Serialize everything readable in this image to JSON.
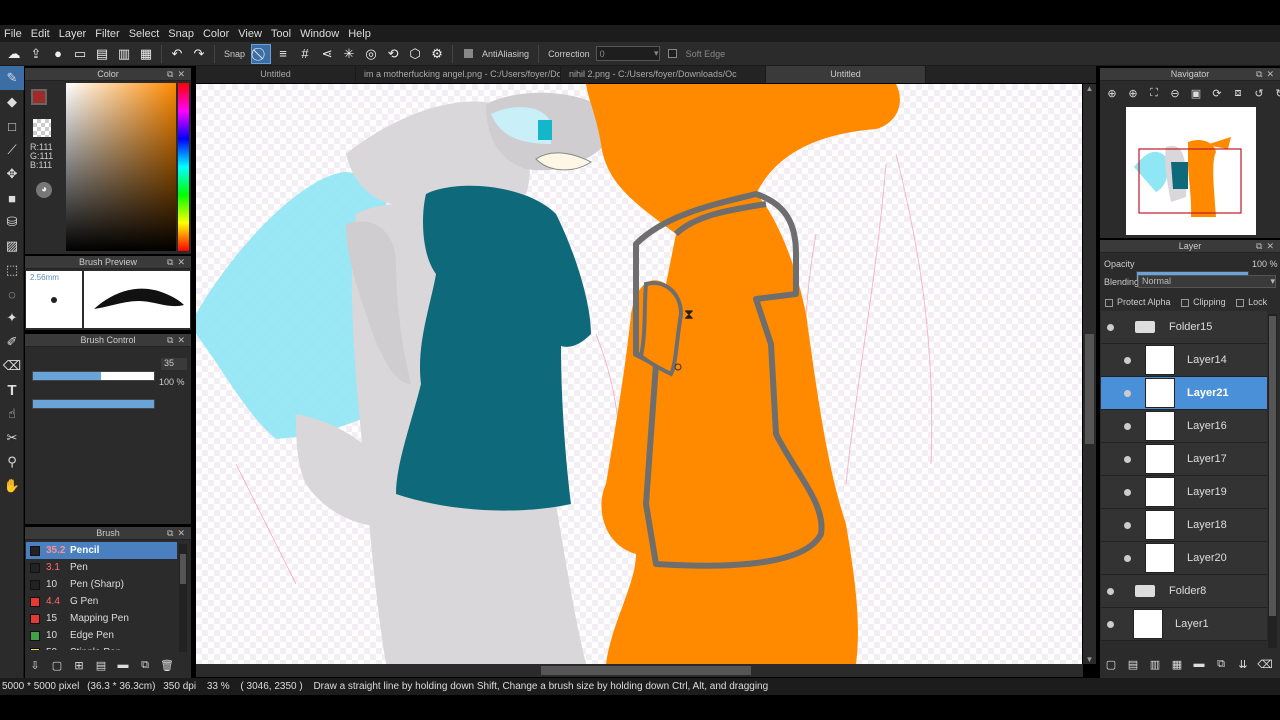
{
  "menu": [
    "File",
    "Edit",
    "Layer",
    "Filter",
    "Select",
    "Snap",
    "Color",
    "View",
    "Tool",
    "Window",
    "Help"
  ],
  "toolbar": {
    "snap_label": "Snap",
    "antialias_label": "AntiAliasing",
    "correction_label": "Correction",
    "correction_value": "0",
    "soft_edge_label": "Soft Edge"
  },
  "color_panel": {
    "title": "Color",
    "r": "R:111",
    "g": "G:111",
    "b": "B:111",
    "fg_color": "#a02a2a"
  },
  "brush_preview": {
    "title": "Brush Preview",
    "size": "2.56mm"
  },
  "brush_control": {
    "title": "Brush Control",
    "size_value": "35",
    "size_fraction": 0.56,
    "opacity_value": "100 %",
    "opacity_fraction": 1.0
  },
  "brush_panel": {
    "title": "Brush",
    "items": [
      {
        "size": "35.2",
        "name": "Pencil",
        "color": "#222222",
        "active": true
      },
      {
        "size": "3.1",
        "name": "Pen",
        "color": "#222222"
      },
      {
        "size": "10",
        "name": "Pen (Sharp)",
        "color": "#222222"
      },
      {
        "size": "4.4",
        "name": "G Pen",
        "color": "#e53935"
      },
      {
        "size": "15",
        "name": "Mapping Pen",
        "color": "#e53935"
      },
      {
        "size": "10",
        "name": "Edge Pen",
        "color": "#43a047"
      },
      {
        "size": "50",
        "name": "Stipple Pen",
        "color": "#fdd835"
      }
    ]
  },
  "tabs": [
    {
      "label": "Untitled"
    },
    {
      "label": "im a motherfucking angel.png - C:/Users/foyer/Downloads/Oc"
    },
    {
      "label": "nihil 2.png - C:/Users/foyer/Downloads/Oc"
    },
    {
      "label": "Untitled",
      "active": true
    }
  ],
  "navigator": {
    "title": "Navigator"
  },
  "layer_panel": {
    "title": "Layer",
    "opacity_label": "Opacity",
    "opacity_value": "100 %",
    "opacity_fraction": 1.0,
    "blending_label": "Blending",
    "blending_value": "Normal",
    "protect_alpha": "Protect Alpha",
    "clipping": "Clipping",
    "lock": "Lock",
    "layers": [
      {
        "name": "Folder15",
        "type": "folder",
        "indent": 0
      },
      {
        "name": "Layer14",
        "type": "layer",
        "indent": 1
      },
      {
        "name": "Layer21",
        "type": "layer",
        "indent": 1,
        "active": true
      },
      {
        "name": "Layer16",
        "type": "layer",
        "indent": 1
      },
      {
        "name": "Layer17",
        "type": "layer",
        "indent": 1
      },
      {
        "name": "Layer19",
        "type": "layer",
        "indent": 1
      },
      {
        "name": "Layer18",
        "type": "layer",
        "indent": 1
      },
      {
        "name": "Layer20",
        "type": "layer",
        "indent": 1
      },
      {
        "name": "Folder8",
        "type": "folder",
        "indent": 0
      },
      {
        "name": "Layer1",
        "type": "layer",
        "indent": 0
      }
    ]
  },
  "statusbar": {
    "canvas_size": "5000 * 5000 pixel",
    "physical_size": "(36.3 * 36.3cm)",
    "dpi": "350 dpi",
    "zoom": "33 %",
    "cursor": "( 3046, 2350 )",
    "hint": "Draw a straight line by holding down Shift, Change a brush size by holding down Ctrl, Alt, and dragging"
  },
  "colors": {
    "accent": "#4a90d9",
    "orange": "#ff8a00",
    "teal": "#0e6a7a",
    "gray_char": "#d9d7d9",
    "wing": "#8fe3f2"
  }
}
